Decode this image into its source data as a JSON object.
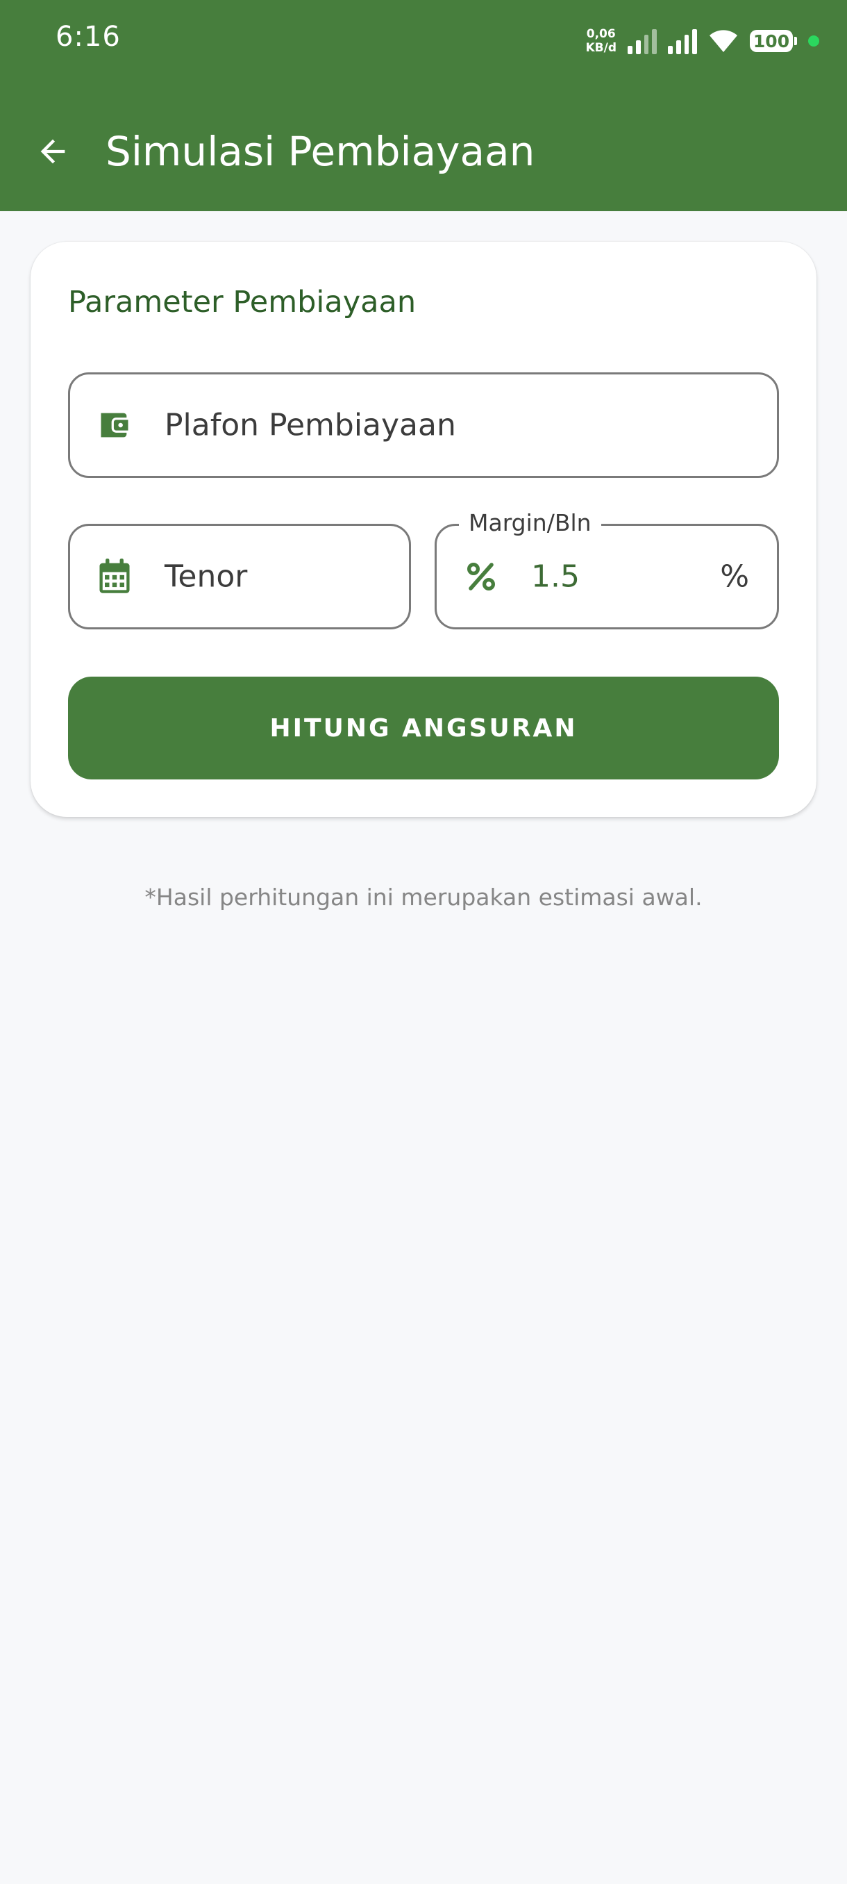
{
  "status_bar": {
    "time": "6:16",
    "net_speed_value": "0,06",
    "net_speed_unit": "KB/d",
    "battery": "100"
  },
  "app_bar": {
    "title": "Simulasi Pembiayaan"
  },
  "card": {
    "title": "Parameter Pembiayaan",
    "plafon_placeholder": "Plafon Pembiayaan",
    "tenor_placeholder": "Tenor",
    "margin_label": "Margin/Bln",
    "margin_value": "1.5",
    "margin_suffix": "%",
    "submit_label": "HITUNG ANGSURAN"
  },
  "disclaimer": "*Hasil perhitungan ini merupakan estimasi awal.",
  "colors": {
    "primary": "#477e3d",
    "title_green": "#2d5e28",
    "background": "#f7f8fa"
  },
  "icons": {
    "back": "arrow-back-icon",
    "plafon": "wallet-icon",
    "tenor": "calendar-icon",
    "margin": "percent-icon"
  }
}
